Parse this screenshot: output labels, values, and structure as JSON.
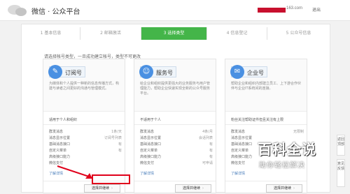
{
  "header": {
    "brand": "微信 · 公众平台",
    "account_suffix": "163.com",
    "logout": "退出"
  },
  "steps": [
    {
      "label": "1 基本信息"
    },
    {
      "label": "2 邮箱激活"
    },
    {
      "label": "3 选择类型"
    },
    {
      "label": "4 信息登记"
    },
    {
      "label": "5 公众号信息"
    }
  ],
  "hint": "请选择帐号类型，一旦成功建立帐号，类型不可更改",
  "cards": [
    {
      "title": "订阅号",
      "icon": "subscription-icon",
      "description": "为媒体和个人提供一种新的信息传播方式，构建与读者之间更好的沟通与管理模式。",
      "fit": "适用于个人和组织",
      "features": [
        {
          "name": "群发消息",
          "value": "1条/天"
        },
        {
          "name": "消息显示位置",
          "value": "订阅号列表"
        },
        {
          "name": "基础消息接口",
          "value": "有"
        },
        {
          "name": "自定义菜单",
          "value": "有"
        },
        {
          "name": "高级接口能力",
          "value": ""
        },
        {
          "name": "微信支付",
          "value": ""
        }
      ],
      "more": "了解详情",
      "choose": "选择并继续"
    },
    {
      "title": "服务号",
      "icon": "service-icon",
      "description": "给企业和组织提供更强大的业务服务与用户管理能力，帮助企业快速实现全新的公众号服务平台。",
      "fit": "不适用于个人",
      "features": [
        {
          "name": "群发消息",
          "value": "4条/月"
        },
        {
          "name": "消息显示位置",
          "value": "会话列表"
        },
        {
          "name": "基础消息接口",
          "value": "有"
        },
        {
          "name": "自定义菜单",
          "value": "有"
        },
        {
          "name": "高级接口能力",
          "value": "有"
        },
        {
          "name": "微信支付",
          "value": "可申请"
        }
      ],
      "more": "了解详情",
      "choose": "选择并继续"
    },
    {
      "title": "企业号",
      "icon": "enterprise-icon",
      "description": "帮助企业和组织内部建立员工、上下游合作伙伴与企业IT系统间的连接。",
      "fit": "粉丝关注帮助证件但且关注有上限",
      "features": [
        {
          "name": "群发消息",
          "value": "无限制"
        },
        {
          "name": "消息显示位置",
          "value": ""
        },
        {
          "name": "基础消息接口",
          "value": ""
        },
        {
          "name": "自定义菜单",
          "value": ""
        },
        {
          "name": "高级接口能力",
          "value": ""
        },
        {
          "name": "微信支付",
          "value": ""
        }
      ],
      "more": "了解详情",
      "choose": "选择并继续"
    }
  ],
  "watermark": {
    "title": "百科全说",
    "subtitle": "助你轻松解决"
  },
  "side": {
    "top_label": "返回顶部",
    "feedback_label": "意见反馈"
  },
  "colors": {
    "accent_green": "#44b549",
    "link_blue": "#4a7ebb",
    "highlight_red": "#e0001b"
  }
}
